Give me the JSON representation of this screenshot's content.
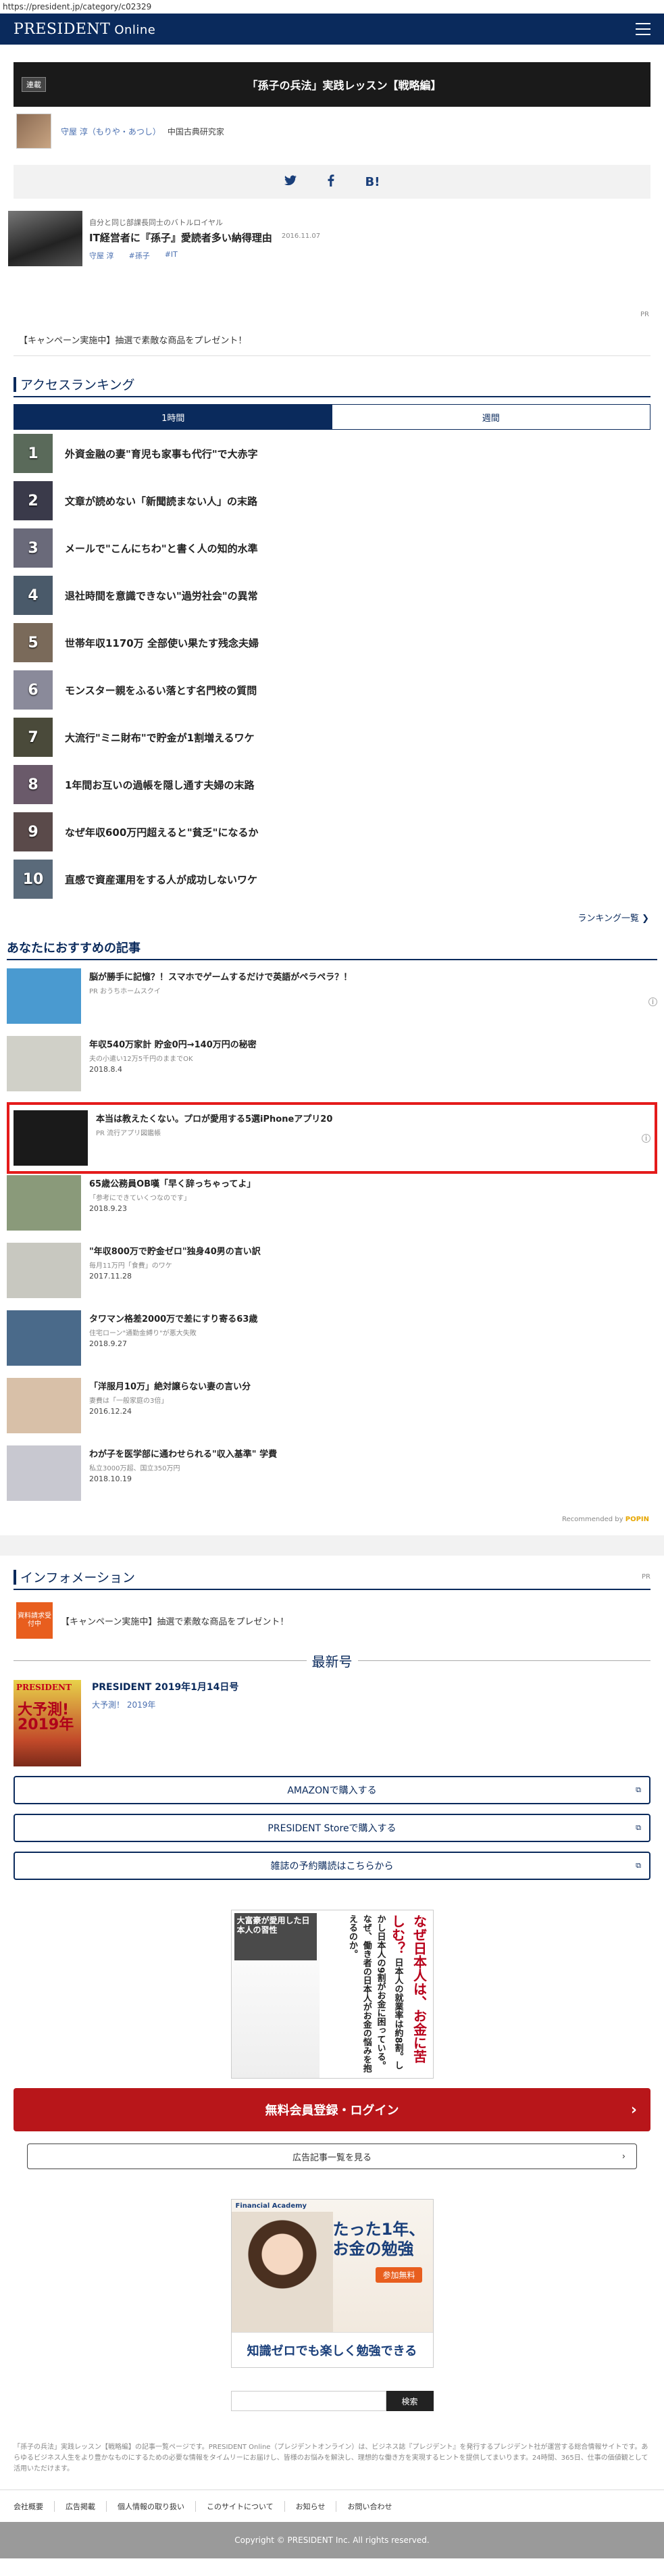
{
  "browser": {
    "url": "https://president.jp/category/c02329"
  },
  "header": {
    "logo": "PRESIDENT",
    "logo_sub": "Online"
  },
  "series": {
    "tag": "連載",
    "title": "「孫子の兵法」実践レッスン【戦略編】"
  },
  "author": {
    "name": "守屋 淳（もりや・あつし）",
    "affiliation": "中国古典研究家"
  },
  "share": {
    "twitter": "t",
    "facebook": "f",
    "hatena": "B!"
  },
  "related": {
    "kicker": "自分と同じ部課長同士のバトルロイヤル",
    "title": "IT経営者に『孫子』愛読者多い納得理由",
    "tags": [
      "守屋 淳",
      "#孫子",
      "#IT"
    ],
    "date": "2016.11.07"
  },
  "pr_label": "PR",
  "campaign_text": "【キャンペーン実施中】抽選で素敵な商品をプレゼント！",
  "ranking": {
    "title": "アクセスランキング",
    "tabs": [
      "1時間",
      "週間"
    ],
    "items": [
      {
        "num": "1",
        "title": "外資金融の妻\"育児も家事も代行\"で大赤字",
        "color": "#5a6a5a"
      },
      {
        "num": "2",
        "title": "文章が読めない「新聞読まない人」の末路",
        "color": "#3a3a4a"
      },
      {
        "num": "3",
        "title": "メールで\"こんにちわ\"と書く人の知的水準",
        "color": "#6a6a7a"
      },
      {
        "num": "4",
        "title": "退社時間を意識できない\"過労社会\"の異常",
        "color": "#4a5a6a"
      },
      {
        "num": "5",
        "title": "世帯年収1170万 全部使い果たす残念夫婦",
        "color": "#7a6a5a"
      },
      {
        "num": "6",
        "title": "モンスター親をふるい落とす名門校の質問",
        "color": "#8a8a9a"
      },
      {
        "num": "7",
        "title": "大流行\"ミニ財布\"で貯金が1割増えるワケ",
        "color": "#4a4a3a"
      },
      {
        "num": "8",
        "title": "1年間お互いの過帳を隠し通す夫婦の末路",
        "color": "#6a5a6a"
      },
      {
        "num": "9",
        "title": "なぜ年収600万円超えると\"貧乏\"になるか",
        "color": "#5a4a4a"
      },
      {
        "num": "10",
        "title": "直感で資産運用をする人が成功しないワケ",
        "color": "#5a6a7a"
      }
    ],
    "more": "ランキング一覧"
  },
  "recommend": {
    "title": "あなたにおすすめの記事",
    "items": [
      {
        "title": "脳が勝手に記憶？！スマホでゲームするだけで英語がペラペラ？！",
        "sub": "PR おうちホームスクイ",
        "date": "",
        "pr": true,
        "highlight": false,
        "thumb": "#4a9ad0"
      },
      {
        "title": "年収540万家計 貯金0円→140万円の秘密",
        "sub": "夫の小遣い12万5千円のままでOK",
        "date": "2018.8.4",
        "pr": false,
        "highlight": false,
        "thumb": "#d0d0c8"
      },
      {
        "title": "本当は教えたくない。プロが愛用する5選iPhoneアプリ20",
        "sub": "PR 流行アプリ図鑑帳",
        "date": "",
        "pr": true,
        "highlight": true,
        "thumb": "#1a1a1a"
      },
      {
        "title": "65歳公務員OB嘆「早く辞っちゃってよ」",
        "sub": "「参考にできていくつなのです」",
        "date": "2018.9.23",
        "pr": false,
        "highlight": false,
        "thumb": "#8a9a7a"
      },
      {
        "title": "\"年収800万で貯金ゼロ\"独身40男の言い訳",
        "sub": "毎月11万円「食費」のワケ",
        "date": "2017.11.28",
        "pr": false,
        "highlight": false,
        "thumb": "#c8c8c0"
      },
      {
        "title": "タワマン格差2000万で差にすり寄る63歳",
        "sub": "住宅ローン\"通勤金縛り\"が悪大失敗",
        "date": "2018.9.27",
        "pr": false,
        "highlight": false,
        "thumb": "#4a6a8a"
      },
      {
        "title": "「洋服月10万」絶対譲らない妻の言い分",
        "sub": "妻費は「一般家庭の3倍」",
        "date": "2016.12.24",
        "pr": false,
        "highlight": false,
        "thumb": "#d8c0a8"
      },
      {
        "title": "わが子を医学部に通わせられる\"収入基準\" 学費",
        "sub": "私立3000万超、国立350万円",
        "date": "2018.10.19",
        "pr": false,
        "highlight": false,
        "thumb": "#c8c8d0"
      }
    ],
    "recommended_by": "Recommended by",
    "recommended_brand": "POPIN"
  },
  "information": {
    "title": "インフォメーション",
    "badge": "資料請求受付中",
    "text": "【キャンペーン実施中】抽選で素敵な商品をプレゼント！"
  },
  "latest": {
    "label": "最新号",
    "cover_brand": "PRESIDENT",
    "cover_year": "大予測! 2019年",
    "issue_title": "PRESIDENT 2019年1月14日号",
    "issue_sub": "大予測！ 2019年"
  },
  "buy_buttons": [
    "AMAZONで購入する",
    "PRESIDENT Storeで購入する",
    "雑誌の予約購読はこちらから"
  ],
  "ad1": {
    "head": "大富豪が愛用した日本人の習性",
    "vertical_red": "なぜ日本人は、お金に苦しむ？",
    "vertical_body": "日本人の就業率は約8割。しかし日本人の9割がお金に困っている。なぜ、働き者の日本人がお金の悩みを抱えるのか。"
  },
  "login_label": "無料会員登録・ログイン",
  "ads_list_label": "広告記事一覧を見る",
  "ad2": {
    "brand": "Financial Academy",
    "copy": "たった1年、お金の勉強",
    "badge": "参加無料",
    "foot": "知識ゼロでも楽しく勉強できる"
  },
  "search": {
    "placeholder": "",
    "button": "検索"
  },
  "description": "「孫子の兵法」実践レッスン【戦略編】の記事一覧ページです。PRESIDENT Online（プレジデントオンライン）は、ビジネス誌『プレジデント』を発行するプレジデント社が運営する総合情報サイトです。あらゆるビジネス人生をより豊かなものにするための必要な情報をタイムリーにお届けし、皆様のお悩みを解決し、理想的な働き方を実現するヒントを提供してまいります。24時間、365日、仕事の価値観として活用いただけます。",
  "footer": {
    "links": [
      "会社概要",
      "広告掲載",
      "個人情報の取り扱い",
      "このサイトについて",
      "お知らせ",
      "お問い合わせ"
    ],
    "copyright": "Copyright © PRESIDENT Inc. All rights reserved."
  }
}
